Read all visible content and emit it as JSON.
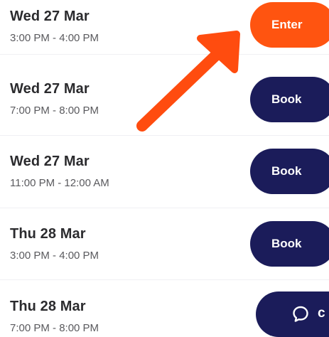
{
  "sessions": [
    {
      "day": "Wed 27 Mar",
      "time": "3:00 PM - 4:00 PM",
      "action": "Enter",
      "style": "enter"
    },
    {
      "day": "Wed 27 Mar",
      "time": "7:00 PM - 8:00 PM",
      "action": "Book",
      "style": "book"
    },
    {
      "day": "Wed 27 Mar",
      "time": "11:00 PM - 12:00 AM",
      "action": "Book",
      "style": "book"
    },
    {
      "day": "Thu 28 Mar",
      "time": "3:00 PM - 4:00 PM",
      "action": "Book",
      "style": "book"
    },
    {
      "day": "Thu 28 Mar",
      "time": "7:00 PM - 8:00 PM",
      "action": "",
      "style": "book"
    }
  ],
  "chat_widget": {
    "label": "c",
    "icon": "chat-bubble-icon"
  },
  "colors": {
    "enter": "#ff5410",
    "book": "#1b1c5a",
    "annotation_arrow": "#ff4c0f"
  },
  "annotation": {
    "icon": "arrow-icon",
    "points_to": "Enter"
  }
}
